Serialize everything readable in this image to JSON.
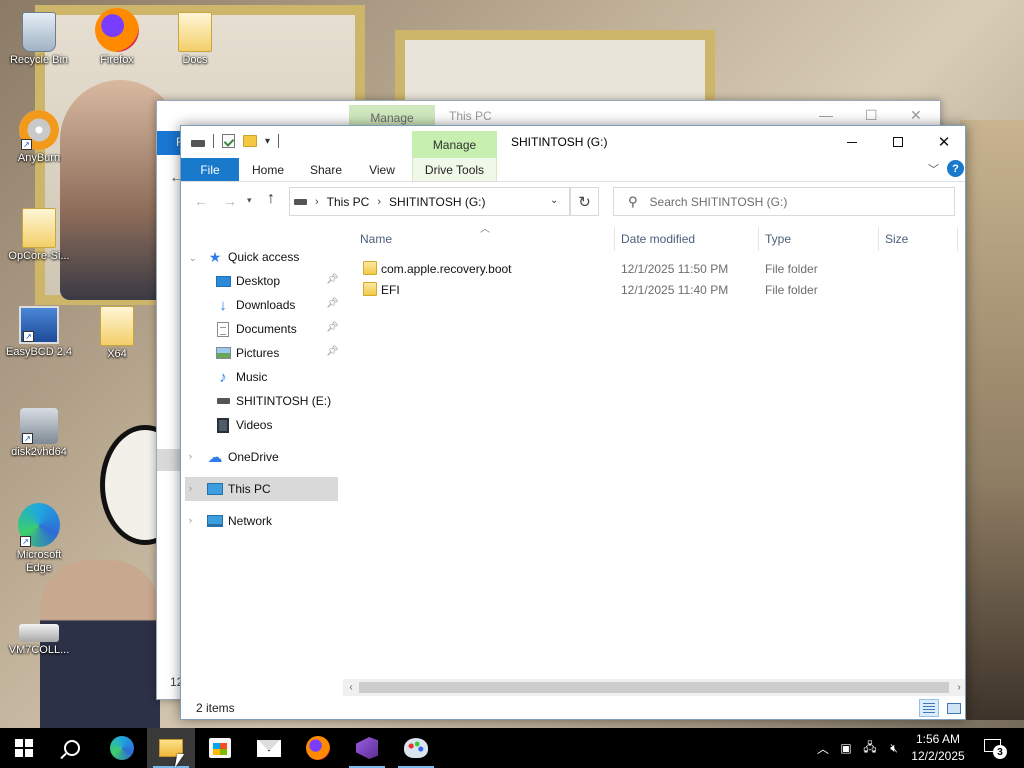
{
  "desktop": {
    "icons": [
      {
        "label": "Recycle Bin",
        "icon": "recycle-bin-icon"
      },
      {
        "label": "Firefox",
        "icon": "firefox-icon"
      },
      {
        "label": "Docs",
        "icon": "folder-icon"
      },
      {
        "label": "AnyBurn",
        "icon": "disc-icon"
      },
      {
        "label": "OpCore-Si...",
        "icon": "folder-icon"
      },
      {
        "label": "EasyBCD 2.4",
        "icon": "easybcd-icon"
      },
      {
        "label": "X64",
        "icon": "folder-icon"
      },
      {
        "label": "disk2vhd64",
        "icon": "disk2vhd-icon"
      },
      {
        "label": "Microsoft Edge",
        "icon": "edge-icon"
      },
      {
        "label": "VM7COLL...",
        "icon": "drive-icon"
      }
    ]
  },
  "background_window": {
    "manage_label": "Manage",
    "title": "This PC",
    "file_tab_initial": "F",
    "status_partial": "12"
  },
  "window": {
    "title": "SHITINTOSH (G:)",
    "manage_label": "Manage",
    "tabs": {
      "file": "File",
      "home": "Home",
      "share": "Share",
      "view": "View",
      "drive_tools": "Drive Tools"
    },
    "help_label": "?",
    "address": {
      "segments": [
        "This PC",
        "SHITINTOSH (G:)"
      ]
    },
    "search": {
      "placeholder": "Search SHITINTOSH (G:)"
    },
    "nav_pane": {
      "quick_access": "Quick access",
      "items": [
        {
          "label": "Desktop",
          "icon": "desktop-icon",
          "pinned": true
        },
        {
          "label": "Downloads",
          "icon": "downloads-icon",
          "pinned": true
        },
        {
          "label": "Documents",
          "icon": "documents-icon",
          "pinned": true
        },
        {
          "label": "Pictures",
          "icon": "pictures-icon",
          "pinned": true
        },
        {
          "label": "Music",
          "icon": "music-icon",
          "pinned": false
        },
        {
          "label": "SHITINTOSH (E:)",
          "icon": "usb-drive-icon",
          "pinned": false
        },
        {
          "label": "Videos",
          "icon": "videos-icon",
          "pinned": false
        }
      ],
      "onedrive": "OneDrive",
      "this_pc": "This PC",
      "network": "Network"
    },
    "columns": {
      "name": "Name",
      "date_modified": "Date modified",
      "type": "Type",
      "size": "Size"
    },
    "files": [
      {
        "name": "com.apple.recovery.boot",
        "date": "12/1/2025 11:50 PM",
        "type": "File folder",
        "size": ""
      },
      {
        "name": "EFI",
        "date": "12/1/2025 11:40 PM",
        "type": "File folder",
        "size": ""
      }
    ],
    "status": {
      "item_count": "2 items"
    }
  },
  "taskbar": {
    "apps": [
      "start-icon",
      "search-icon",
      "edge-icon",
      "file-explorer-icon",
      "store-icon",
      "mail-icon",
      "firefox-icon",
      "visual-studio-icon",
      "paint-icon"
    ],
    "clock": {
      "time": "1:56 AM",
      "date": "12/2/2025"
    },
    "notification_count": "3"
  },
  "colors": {
    "accent": "#1979ca",
    "manage_tab": "#c6efb0",
    "selection": "#d9d9d9",
    "taskbar": "#000000"
  }
}
